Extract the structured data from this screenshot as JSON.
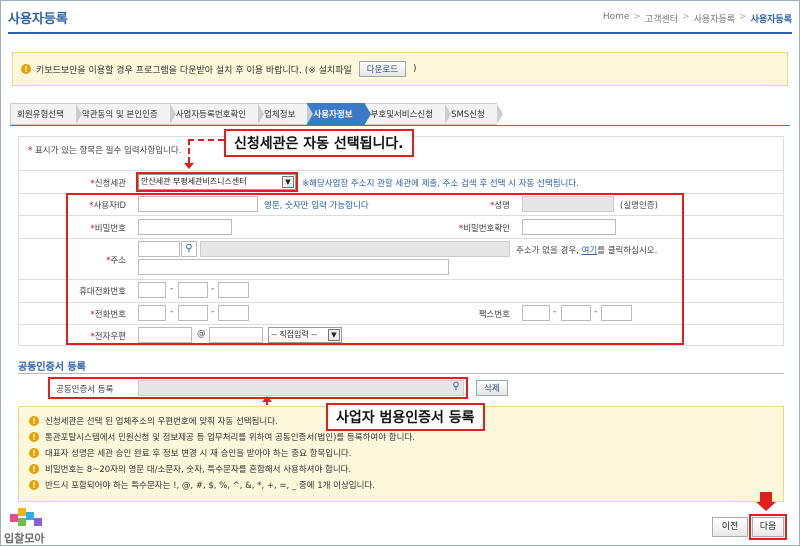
{
  "header": {
    "title": "사용자등록",
    "breadcrumb": [
      "Home",
      "고객센터",
      "사용자등록",
      "사용자등록"
    ]
  },
  "notice": {
    "text": "키보드보안을 이용할 경우 프로그램을 다운받아 설치 후 이용 바랍니다. (※ 설치파일",
    "download_label": "다운로드",
    "close_paren": ")"
  },
  "steps": [
    {
      "label": "회원유형선택",
      "active": false
    },
    {
      "label": "약관동의 및 본인인증",
      "active": false
    },
    {
      "label": "사업자등록번호확인",
      "active": false
    },
    {
      "label": "업체정보",
      "active": false
    },
    {
      "label": "사용자정보",
      "active": true
    },
    {
      "label": "부호및서비스신청",
      "active": false
    },
    {
      "label": "SMS신청",
      "active": false
    }
  ],
  "form": {
    "required_note_star": "*",
    "required_note": " 표시가 있는 항목은 필수 입력사항입니다.",
    "customs": {
      "label": "신청세관",
      "selected": "안산세관 부평세관비즈니스센터",
      "hint": "※해당사업장 주소지 관할 세관에 제출, 주소 검색 후 선택 시 자동 선택됩니다."
    },
    "user_id": {
      "label": "사용자ID",
      "hint": "영문, 숫자만 입력 가능합니다"
    },
    "name": {
      "label": "성명",
      "note": "(실명인증)"
    },
    "password": {
      "label": "비밀번호"
    },
    "password_confirm": {
      "label": "비밀번호확인"
    },
    "address": {
      "label": "주소",
      "hint_before": "주소가 없을 경우, ",
      "hint_link": "여기",
      "hint_after": "를 클릭하십시오."
    },
    "mobile": {
      "label": "휴대전화번호"
    },
    "phone": {
      "label": "전화번호"
    },
    "fax": {
      "label": "팩스번호"
    },
    "email": {
      "label": "전자우편",
      "at": "@",
      "select": "-- 직접입력 --"
    },
    "dash": "-"
  },
  "callouts": {
    "customs": "신청세관은 자동 선택됩니다.",
    "cert": "사업자 범용인증서 등록"
  },
  "cert": {
    "section_title": "공동인증서 등록",
    "label": "공동인증서 등록",
    "delete_label": "삭제"
  },
  "notes": [
    "신청세관은 선택 된 업체주소의 우편번호에 맞춰 자동 선택됩니다.",
    "통관포탈시스템에서 민원신청 및 정보제공 등 업무처리를 위하여 공동인증서(법인)를 등록하여야 합니다.",
    "대표자 성명은 세관 승인 완료 후 정보 변경 시 재 승인을 받아야 하는 중요 항목입니다.",
    "비밀번호는 8~20자의 영문 대/소문자, 숫자, 특수문자를 혼합해서 사용하셔야 합니다.",
    "반드시 포함되어야 하는 특수문자는 !, @, #, $, %, ^, &, *, +, =, _ 중에 1개 이상입니다."
  ],
  "buttons": {
    "prev": "이전",
    "next": "다음"
  },
  "logo": {
    "text": "입찰모아"
  },
  "colors": {
    "accent": "#2a61a8",
    "highlight": "#e0201e",
    "notice_bg": "#fdf7dc"
  }
}
